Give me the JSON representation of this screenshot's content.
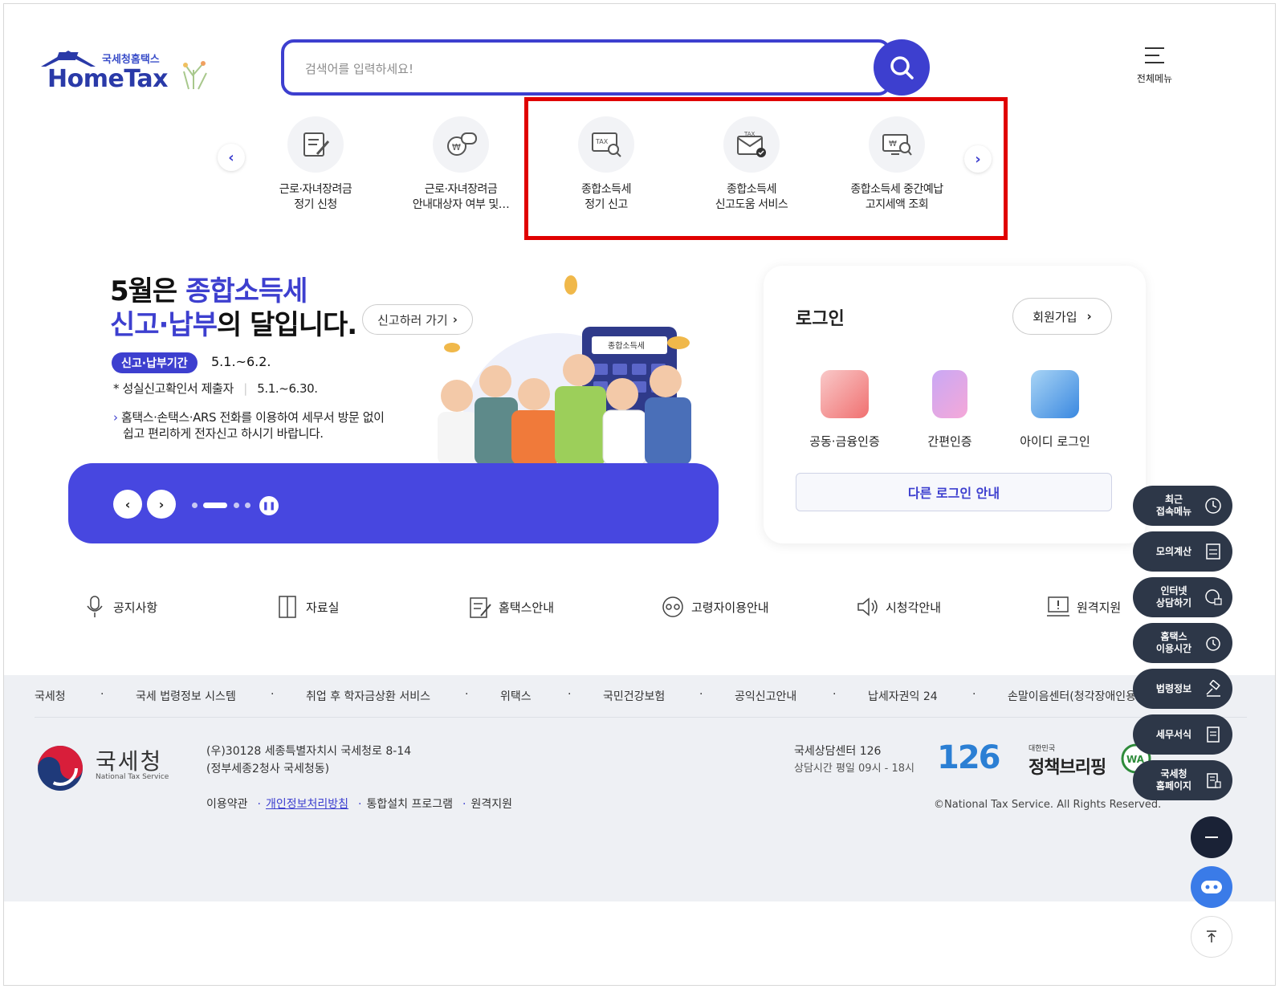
{
  "header": {
    "logo_small": "국세청홈택스",
    "logo_big": "HomeTax",
    "search_placeholder": "검색어를 입력하세요!",
    "menu_label": "전체메뉴"
  },
  "quick_menu": [
    {
      "l1": "근로·자녀장려금",
      "l2": "정기 신청",
      "icon": "form-pen-icon"
    },
    {
      "l1": "근로·자녀장려금",
      "l2": "안내대상자 여부 및…",
      "icon": "coin-chat-icon"
    },
    {
      "l1": "종합소득세",
      "l2": "정기 신고",
      "icon": "tax-search-icon"
    },
    {
      "l1": "종합소득세",
      "l2": "신고도움 서비스",
      "icon": "tax-mail-icon"
    },
    {
      "l1": "종합소득세 중간예납",
      "l2": "고지세액 조회",
      "icon": "monitor-search-icon"
    }
  ],
  "banner": {
    "title_part1": "5월은 ",
    "title_highlight1": "종합소득세",
    "title_highlight2": "신고·납부",
    "title_part2": "의 달입니다.",
    "go_button": "신고하러 가기",
    "period_badge": "신고·납부기간",
    "period_date": "5.1.~6.2.",
    "line1_label": "성실신고확인서 제출자",
    "line1_date": "5.1.~6.30.",
    "line2": "홈택스·손택스·ARS 전화를 이용하여 세무서 방문 없이",
    "line3": "쉽고 편리하게 전자신고 하시기 바랍니다.",
    "calculator_label": "종합소득세"
  },
  "login": {
    "title": "로그인",
    "join_button": "회원가입",
    "methods": [
      "공동·금융인증",
      "간편인증",
      "아이디 로그인"
    ],
    "other_button": "다른 로그인 안내"
  },
  "quick_links": [
    "공지사항",
    "자료실",
    "홈택스안내",
    "고령자이용안내",
    "시청각안내",
    "원격지원"
  ],
  "footer": {
    "links": [
      "국세청",
      "국세 법령정보 시스템",
      "취업 후 학자금상환 서비스",
      "위택스",
      "국민건강보험",
      "공익신고안내",
      "납세자권익 24",
      "손말이음센터(청각장애인용"
    ],
    "org_name": "국세청",
    "org_en": "National Tax Service",
    "address1": "(우)30128 세종특별자치시 국세청로 8-14",
    "address2": "(정부세종2청사 국세청동)",
    "nav": [
      "이용약관",
      "개인정보처리방침",
      "통합설치 프로그램",
      "원격지원"
    ],
    "call_center": "국세상담센터 126",
    "call_hours": "상담시간 평일 09시 - 18시",
    "badge_126": "126",
    "brief_small": "대한민국",
    "brief_big": "정책브리핑",
    "copyright": "©National Tax Service. All Rights Reserved."
  },
  "floating": [
    {
      "label": "최근\n접속메뉴",
      "icon": "clock-icon"
    },
    {
      "label": "모의계산",
      "icon": "calculator-icon"
    },
    {
      "label": "인터넷\n상담하기",
      "icon": "chat-icon"
    },
    {
      "label": "홈택스\n이용시간",
      "icon": "alarm-icon"
    },
    {
      "label": "법령정보",
      "icon": "gavel-icon"
    },
    {
      "label": "세무서식",
      "icon": "document-icon"
    },
    {
      "label": "국세청\n홈페이지",
      "icon": "building-icon"
    }
  ],
  "colors": {
    "brand": "#3d3fcf",
    "banner_bar": "#4747e0",
    "highlight_box": "#e00000",
    "floating_bg": "#2d3748"
  }
}
